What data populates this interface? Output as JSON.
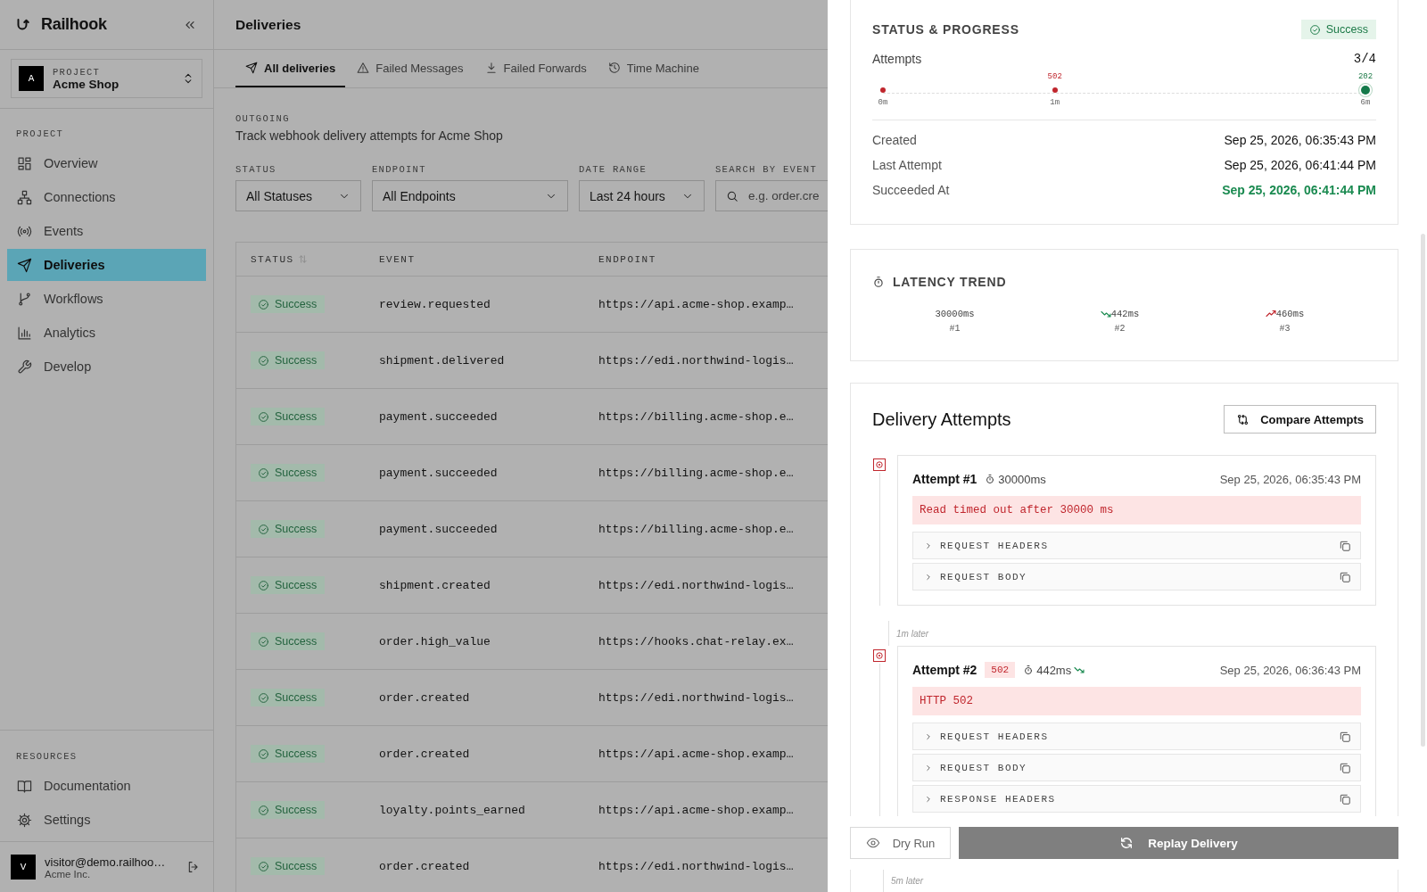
{
  "sidebar": {
    "brand": "Railhook",
    "project": {
      "avatar": "A",
      "label": "PROJECT",
      "name": "Acme Shop"
    },
    "section": "PROJECT",
    "items": [
      {
        "label": "Overview",
        "selected": false
      },
      {
        "label": "Connections",
        "selected": false
      },
      {
        "label": "Events",
        "selected": false
      },
      {
        "label": "Deliveries",
        "selected": true
      },
      {
        "label": "Workflows",
        "selected": false
      },
      {
        "label": "Analytics",
        "selected": false
      },
      {
        "label": "Develop",
        "selected": false
      }
    ],
    "resources_title": "RESOURCES",
    "resources": [
      {
        "label": "Documentation"
      },
      {
        "label": "Settings"
      }
    ],
    "user": {
      "avatar": "V",
      "email": "visitor@demo.railhoo…",
      "org": "Acme Inc."
    }
  },
  "main": {
    "title": "Deliveries",
    "tabs": [
      {
        "label": "All deliveries",
        "selected": true
      },
      {
        "label": "Failed Messages",
        "selected": false
      },
      {
        "label": "Failed Forwards",
        "selected": false
      },
      {
        "label": "Time Machine",
        "selected": false
      }
    ],
    "eyebrow": "OUTGOING",
    "description": "Track webhook delivery attempts for Acme Shop",
    "filters": [
      {
        "kind": "select",
        "label": "STATUS",
        "value": "All Statuses"
      },
      {
        "kind": "select",
        "label": "ENDPOINT",
        "value": "All Endpoints"
      },
      {
        "kind": "select",
        "label": "DATE RANGE",
        "value": "Last 24 hours"
      },
      {
        "kind": "search",
        "label": "SEARCH BY EVENT",
        "placeholder": "e.g. order.cre"
      }
    ],
    "table": {
      "columns": [
        "STATUS",
        "EVENT",
        "ENDPOINT"
      ],
      "rows": [
        {
          "status": "Success",
          "event": "review.requested",
          "endpoint": "https://api.acme-shop.examp…"
        },
        {
          "status": "Success",
          "event": "shipment.delivered",
          "endpoint": "https://edi.northwind-logis…"
        },
        {
          "status": "Success",
          "event": "payment.succeeded",
          "endpoint": "https://billing.acme-shop.e…"
        },
        {
          "status": "Success",
          "event": "payment.succeeded",
          "endpoint": "https://billing.acme-shop.e…"
        },
        {
          "status": "Success",
          "event": "payment.succeeded",
          "endpoint": "https://billing.acme-shop.e…"
        },
        {
          "status": "Success",
          "event": "shipment.created",
          "endpoint": "https://edi.northwind-logis…"
        },
        {
          "status": "Success",
          "event": "order.high_value",
          "endpoint": "https://hooks.chat-relay.ex…"
        },
        {
          "status": "Success",
          "event": "order.created",
          "endpoint": "https://edi.northwind-logis…"
        },
        {
          "status": "Success",
          "event": "order.created",
          "endpoint": "https://api.acme-shop.examp…"
        },
        {
          "status": "Success",
          "event": "loyalty.points_earned",
          "endpoint": "https://api.acme-shop.examp…"
        },
        {
          "status": "Success",
          "event": "order.created",
          "endpoint": "https://edi.northwind-logis…"
        }
      ]
    }
  },
  "drawer": {
    "status_card": {
      "title": "STATUS & PROGRESS",
      "status": "Success",
      "attempts_label": "Attempts",
      "attempts_count": "3/4",
      "timeline": [
        {
          "time": "0m",
          "failed": true
        },
        {
          "time": "1m",
          "code": "502",
          "failed": true
        },
        {
          "time": "6m",
          "code": "202",
          "failed": false
        }
      ],
      "details": [
        {
          "label": "Created",
          "value": "Sep 25, 2026, 06:35:43 PM",
          "highlighted": false
        },
        {
          "label": "Last Attempt",
          "value": "Sep 25, 2026, 06:41:44 PM",
          "highlighted": false
        },
        {
          "label": "Succeeded At",
          "value": "Sep 25, 2026, 06:41:44 PM",
          "highlighted": true
        }
      ]
    },
    "latency": {
      "title": "LATENCY TREND",
      "items": [
        {
          "kind": "baseline",
          "value": "30000ms",
          "label": "#1"
        },
        {
          "kind": "faster",
          "value": "442ms",
          "label": "#2"
        },
        {
          "kind": "slower",
          "value": "460ms",
          "label": "#3"
        }
      ]
    },
    "attempts": {
      "title": "Delivery Attempts",
      "compare_button": "Compare Attempts",
      "items": [
        {
          "kind": "attempt",
          "title": "Attempt #1",
          "duration": "30000ms",
          "faster": false,
          "time": "Sep 25, 2026, 06:35:43 PM",
          "error": "Read timed out after 30000 ms",
          "sections": [
            "REQUEST HEADERS",
            "REQUEST BODY"
          ]
        },
        {
          "kind": "gap",
          "label": "1m later"
        },
        {
          "kind": "attempt",
          "title": "Attempt #2",
          "code": "502",
          "duration": "442ms",
          "faster": true,
          "time": "Sep 25, 2026, 06:36:43 PM",
          "error": "HTTP 502",
          "sections": [
            "REQUEST HEADERS",
            "REQUEST BODY",
            "RESPONSE HEADERS"
          ]
        }
      ],
      "tail": "5m later"
    },
    "footer": {
      "dry_run": "Dry Run",
      "replay": "Replay Delivery"
    }
  }
}
